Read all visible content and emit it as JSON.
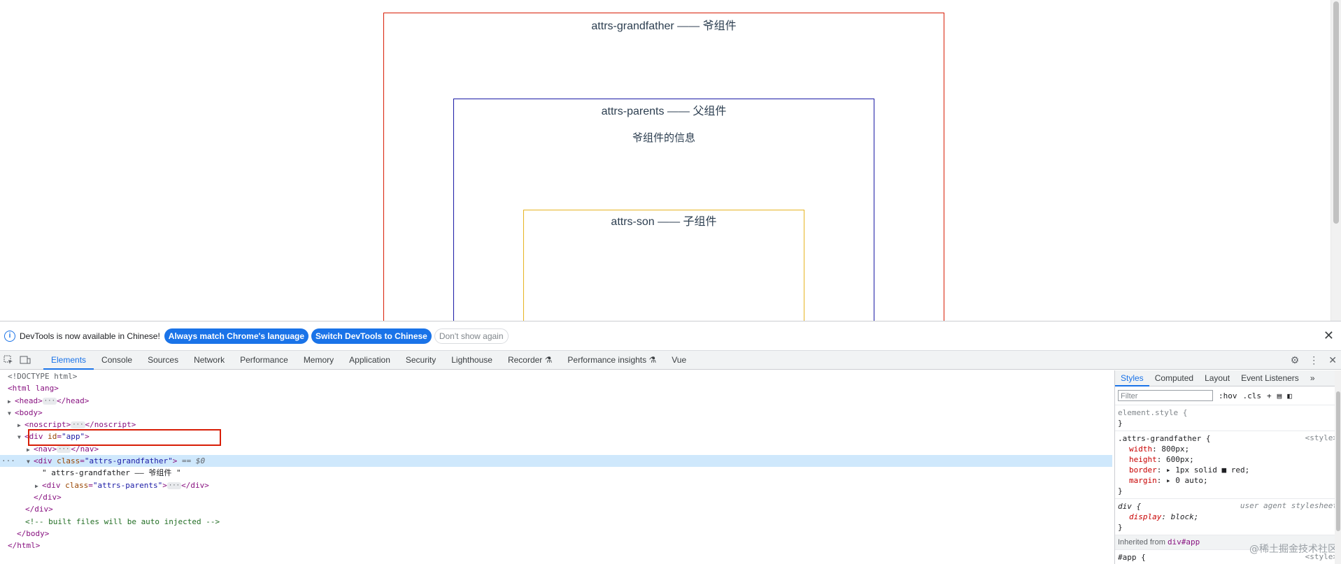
{
  "page": {
    "grandfather_title": "attrs-grandfather —— 爷组件",
    "parents_title": "attrs-parents —— 父组件",
    "grandfather_info": "爷组件的信息",
    "son_title": "attrs-son —— 子组件"
  },
  "infobar": {
    "message": "DevTools is now available in Chinese!",
    "btn_match": "Always match Chrome's language",
    "btn_switch": "Switch DevTools to Chinese",
    "btn_dont": "Don't show again",
    "close": "✕"
  },
  "tabs": {
    "items": [
      "Elements",
      "Console",
      "Sources",
      "Network",
      "Performance",
      "Memory",
      "Application",
      "Security",
      "Lighthouse",
      "Recorder ⚗",
      "Performance insights ⚗",
      "Vue"
    ],
    "active": "Elements"
  },
  "dom": {
    "doctype": "<!DOCTYPE html>",
    "html_open": "<html lang>",
    "head": "<head>",
    "head_close": "</head>",
    "body_open": "<body>",
    "noscript": "<noscript>",
    "noscript_close": "</noscript>",
    "div_app_tag": "<div ",
    "div_app_attr": "id",
    "div_app_val": "\"app\"",
    "nav": "<nav>",
    "nav_close": "</nav>",
    "gf_tag": "<div ",
    "gf_attr": "class",
    "gf_val": "\"attrs-grandfather\"",
    "gf_eq": " == $0",
    "gf_text": "\" attrs-grandfather —— 爷组件 \"",
    "pa_tag": "<div ",
    "pa_attr": "class",
    "pa_val": "\"attrs-parents\"",
    "pa_close": "</div>",
    "div_close_1": "</div>",
    "div_close_2": "</div>",
    "comment": "<!-- built files will be auto injected -->",
    "body_close": "</body>",
    "html_close": "</html>"
  },
  "styles": {
    "tabs": [
      "Styles",
      "Computed",
      "Layout",
      "Event Listeners",
      "»"
    ],
    "filter_placeholder": "Filter",
    "hov": ":hov",
    "cls": ".cls",
    "element_style": "element.style {",
    "close_brace": "}",
    "rule1_selector": ".attrs-grandfather {",
    "rule1_source": "<style>",
    "rule1_props": [
      {
        "name": "width",
        "value": "800px;"
      },
      {
        "name": "height",
        "value": "600px;"
      },
      {
        "name": "border",
        "value": "▸ 1px solid ■ red;"
      },
      {
        "name": "margin",
        "value": "▸ 0 auto;"
      }
    ],
    "rule2_selector": "div {",
    "rule2_source": "user agent stylesheet",
    "rule2_prop_name": "display",
    "rule2_prop_value": "block;",
    "inherited_label": "Inherited from",
    "inherited_ref": "div#app",
    "app_selector": "#app {",
    "app_source": "<style>"
  },
  "watermark": "@稀土掘金技术社区"
}
